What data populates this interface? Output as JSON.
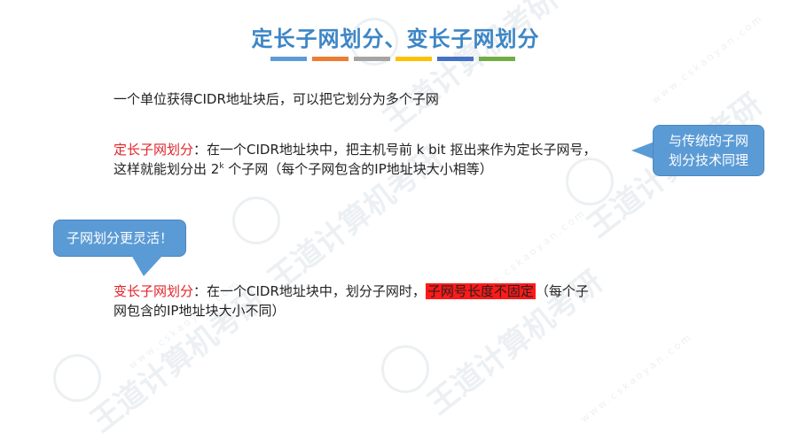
{
  "title": "定长子网划分、变长子网划分",
  "colors": {
    "title": "#3d86c6",
    "accent_bars": [
      "#5b9bd5",
      "#ed7d31",
      "#a5a5a5",
      "#ffc000",
      "#4472c4",
      "#70ad47"
    ],
    "red_text": "#e0242a",
    "highlight": "#ff1a1a",
    "bubble": "#5b9bd5"
  },
  "intro": "一个单位获得CIDR地址块后，可以把它划分为多个子网",
  "fixed": {
    "term": "定长子网划分",
    "line1": "：在一个CIDR地址块中，把主机号前 k bit 抠出来作为定长子网号，",
    "line2_a": "这样就能划分出 2",
    "line2_sup": "k",
    "line2_b": " 个子网（每个子网包含的IP地址块大小相等）"
  },
  "variable": {
    "term": "变长子网划分",
    "line1_a": "：在一个CIDR地址块中，划分子网时，",
    "highlight": "子网号长度不固定",
    "line1_b": "（每个子",
    "line2": "网包含的IP地址块大小不同）"
  },
  "bubble_right": {
    "line1": "与传统的子网",
    "line2": "划分技术同理"
  },
  "bubble_left": "子网划分更灵活！",
  "watermark": {
    "text": "王道计算机考研",
    "url": "www.cskaoyan.com"
  }
}
